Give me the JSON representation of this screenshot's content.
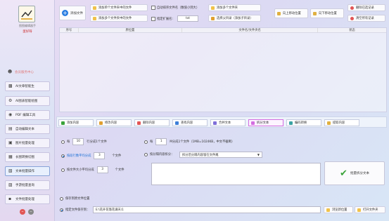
{
  "sidebar": {
    "app_title": "图图编辑器手",
    "user_name": "蛋好呀",
    "items": [
      {
        "label": "会员服务中心",
        "icon": "user-icon"
      },
      {
        "label": "AI文章智能生",
        "icon": "ai-icon"
      },
      {
        "label": "AI图表智能绘图",
        "icon": "chart-icon"
      },
      {
        "label": "PDF 编辑工具",
        "icon": "pdf-icon"
      },
      {
        "label": "自动编辑文本",
        "icon": "text-icon"
      },
      {
        "label": "图片批量处理",
        "icon": "image-icon"
      },
      {
        "label": "长图转换切图",
        "icon": "crop-icon"
      },
      {
        "label": "文本批量操作",
        "icon": "doc-icon"
      },
      {
        "label": "手游批量查询",
        "icon": "truck-icon"
      },
      {
        "label": "文件批量处理",
        "icon": "file-icon"
      }
    ]
  },
  "toolbar": {
    "add_file": "添加文件",
    "add_single_folder": "添加单个文件夹中的文件",
    "add_multi_folder": "添加多个文件夹中的文件",
    "auto_sort": "自动排序文件名（数值小到大）",
    "specify_ext": "指定扩展名:",
    "ext_value": "txt",
    "add_multi_folders": "添加多个文件夹",
    "select_subdir": "选择父目录（添加子目录）",
    "move_up": "向上移动位置",
    "move_down": "向下移动位置",
    "delete_selected": "删除已选记录",
    "clear_all": "清空所有记录"
  },
  "table": {
    "headers": [
      "序号",
      "原位置",
      "文件名/文件夹名",
      "状态"
    ]
  },
  "tabs": [
    {
      "label": "添加内容"
    },
    {
      "label": "修改内容"
    },
    {
      "label": "删除内容"
    },
    {
      "label": "查找内容"
    },
    {
      "label": "合并文本"
    },
    {
      "label": "拆分文本"
    },
    {
      "label": "编码转换"
    },
    {
      "label": "提取内容"
    }
  ],
  "split": {
    "opt1_prefix": "每",
    "opt1_value": "10",
    "opt1_suffix": "行分成1个文件",
    "opt2_prefix": "每",
    "opt2_value": "1",
    "opt2_suffix": "M分成1个文件（1MB=1024KB，中文不截断）",
    "opt3_label": "按段行数平均分成",
    "opt3_value": "3",
    "opt3_suffix": "个文件",
    "opt4_label": "按分隔内容拆分：",
    "opt4_select": "拆分后分隔内容留在文件尾",
    "opt5_label": "按文件大小平均分成",
    "opt5_value": "3",
    "opt5_suffix": "个文件",
    "run_button": "批量拆分文本"
  },
  "output": {
    "save_original": "保存到原文件位置",
    "save_specified": "指定文件保存到：",
    "path_value": "E:\\花开花落花满天\\1",
    "browse": "浏览新位置",
    "open_folder": "打开文件夹"
  },
  "colors": {
    "accent": "#1a6fd6",
    "active_tab_border": "#d36de0",
    "warn": "#e25555"
  }
}
